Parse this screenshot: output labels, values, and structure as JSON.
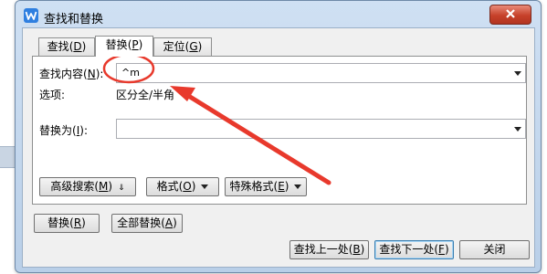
{
  "window": {
    "title": "查找和替换",
    "close_label": "x"
  },
  "tabs": [
    {
      "label": "查找",
      "key": "D",
      "active": false
    },
    {
      "label": "替换",
      "key": "P",
      "active": true
    },
    {
      "label": "定位",
      "key": "G",
      "active": false
    }
  ],
  "find": {
    "label_prefix": "查找内容",
    "key": "N",
    "label_suffix": ":",
    "value": "^m"
  },
  "options": {
    "label": "选项:",
    "value": "区分全/半角"
  },
  "replace": {
    "label_prefix": "替换为",
    "key": "I",
    "label_suffix": ":",
    "value": ""
  },
  "panel_buttons": {
    "advanced": "高级搜索",
    "advanced_key": "M",
    "format": "格式",
    "format_key": "O",
    "special": "特殊格式",
    "special_key": "E"
  },
  "bottom_buttons": {
    "replace": "替换",
    "replace_key": "R",
    "replace_all": "全部替换",
    "replace_all_key": "A",
    "find_prev": "查找上一处",
    "find_prev_key": "B",
    "find_next": "查找下一处",
    "find_next_key": "F",
    "close": "关闭"
  },
  "annotation": {
    "color": "#e8392c",
    "icons": [
      "red-ellipse-annotation",
      "red-arrow-annotation"
    ]
  }
}
